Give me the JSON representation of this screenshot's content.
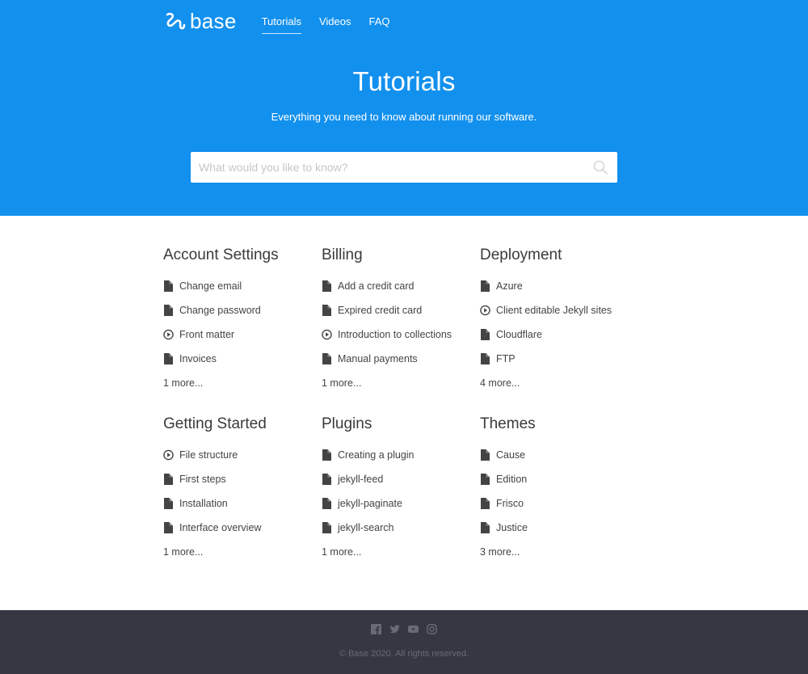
{
  "brand": {
    "name": "base"
  },
  "nav": {
    "links": [
      "Tutorials",
      "Videos",
      "FAQ"
    ],
    "active": "Tutorials"
  },
  "hero": {
    "title": "Tutorials",
    "subtitle": "Everything you need to know about running our software."
  },
  "search": {
    "placeholder": "What would you like to know?",
    "icon": "search-icon"
  },
  "categories": [
    {
      "title": "Account Settings",
      "items": [
        {
          "label": "Change email",
          "icon": "document-icon"
        },
        {
          "label": "Change password",
          "icon": "document-icon"
        },
        {
          "label": "Front matter",
          "icon": "play-circle-icon"
        },
        {
          "label": "Invoices",
          "icon": "document-icon"
        }
      ],
      "more": "1 more..."
    },
    {
      "title": "Billing",
      "items": [
        {
          "label": "Add a credit card",
          "icon": "document-icon"
        },
        {
          "label": "Expired credit card",
          "icon": "document-icon"
        },
        {
          "label": "Introduction to collections",
          "icon": "play-circle-icon"
        },
        {
          "label": "Manual payments",
          "icon": "document-icon"
        }
      ],
      "more": "1 more..."
    },
    {
      "title": "Deployment",
      "items": [
        {
          "label": "Azure",
          "icon": "document-icon"
        },
        {
          "label": "Client editable Jekyll sites",
          "icon": "play-circle-icon"
        },
        {
          "label": "Cloudflare",
          "icon": "document-icon"
        },
        {
          "label": "FTP",
          "icon": "document-icon"
        }
      ],
      "more": "4 more..."
    },
    {
      "title": "Getting Started",
      "items": [
        {
          "label": "File structure",
          "icon": "play-circle-icon"
        },
        {
          "label": "First steps",
          "icon": "document-icon"
        },
        {
          "label": "Installation",
          "icon": "document-icon"
        },
        {
          "label": "Interface overview",
          "icon": "document-icon"
        }
      ],
      "more": "1 more..."
    },
    {
      "title": "Plugins",
      "items": [
        {
          "label": "Creating a plugin",
          "icon": "document-icon"
        },
        {
          "label": "jekyll-feed",
          "icon": "document-icon"
        },
        {
          "label": "jekyll-paginate",
          "icon": "document-icon"
        },
        {
          "label": "jekyll-search",
          "icon": "document-icon"
        }
      ],
      "more": "1 more..."
    },
    {
      "title": "Themes",
      "items": [
        {
          "label": "Cause",
          "icon": "document-icon"
        },
        {
          "label": "Edition",
          "icon": "document-icon"
        },
        {
          "label": "Frisco",
          "icon": "document-icon"
        },
        {
          "label": "Justice",
          "icon": "document-icon"
        }
      ],
      "more": "3 more..."
    }
  ],
  "footer": {
    "social": [
      "facebook-icon",
      "twitter-icon",
      "youtube-icon",
      "instagram-icon"
    ],
    "copyright": "© Base 2020. All rights reserved."
  },
  "colors": {
    "brand_blue": "#1290ee",
    "footer_bg": "#373743",
    "text": "#3a3a3a",
    "icon": "#444444"
  }
}
